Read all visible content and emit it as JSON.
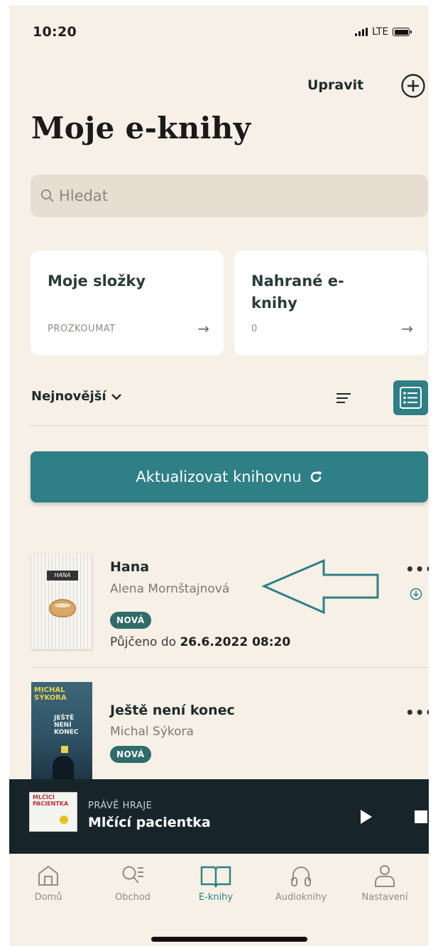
{
  "status_bar": {
    "time": "10:20",
    "network": "LTE"
  },
  "header": {
    "edit_label": "Upravit",
    "add_icon": "plus-circle-icon",
    "title": "Moje e-knihy"
  },
  "search": {
    "placeholder": "Hledat",
    "icon": "search-icon"
  },
  "cards": [
    {
      "title": "Moje složky",
      "subtitle": "PROZKOUMAT",
      "arrow": "→"
    },
    {
      "title": "Nahrané e-knihy",
      "subtitle": "0",
      "arrow": "→"
    }
  ],
  "sort": {
    "label": "Nejnovější",
    "icon": "chevron-down-icon"
  },
  "refresh": {
    "label": "Aktualizovat knihovnu",
    "icon": "refresh-icon"
  },
  "books": [
    {
      "title": "Hana",
      "author": "Alena Mornštajnová",
      "badge": "NOVÁ",
      "loan_prefix": "Půjčeno do",
      "loan_date": "26.6.2022 08:20",
      "more": "•••",
      "cover_text": "HANA"
    },
    {
      "title": "Ještě není konec",
      "author": "Michal Sýkora",
      "badge": "NOVÁ",
      "more": "•••",
      "cover_text_1": "MICHAL SÝKORA",
      "cover_text_2": "JEŠTĚ NENÍ KONEC"
    }
  ],
  "now_playing": {
    "label": "PRÁVĚ HRAJE",
    "title": "Mlčící pacientka",
    "cover_text": "MLČÍCÍ PACIENTKA"
  },
  "tabs": [
    {
      "label": "Domů",
      "icon": "home-icon",
      "active": false
    },
    {
      "label": "Obchod",
      "icon": "store-search-icon",
      "active": false
    },
    {
      "label": "E-knihy",
      "icon": "open-book-icon",
      "active": true
    },
    {
      "label": "Audioknihy",
      "icon": "headphones-icon",
      "active": false
    },
    {
      "label": "Nastavení",
      "icon": "user-icon",
      "active": false
    }
  ],
  "colors": {
    "background": "#f6f0e6",
    "accent": "#2e7f86",
    "badge": "#2f6c6a",
    "player": "#17252b",
    "annotation_arrow": "#2e7f86"
  }
}
